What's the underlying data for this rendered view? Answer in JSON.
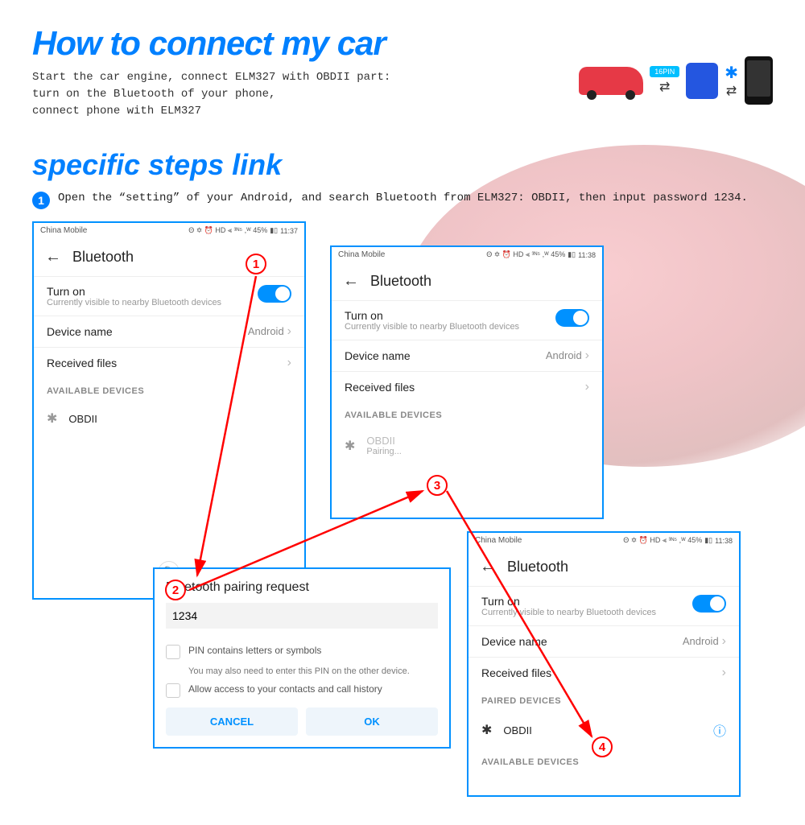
{
  "title1": "How to connect my car",
  "intro_line1": "Start the car engine, connect ELM327 with OBDII part:",
  "intro_line2": "turn on the Bluetooth of your phone,",
  "intro_line3": "connect phone with ELM327",
  "diagram": {
    "pin_label": "16PIN"
  },
  "title2": "specific steps link",
  "step1_text": "Open the “setting” of your Android, and search Bluetooth from ELM327: OBDII, then input password 1234.",
  "status": {
    "carrier": "China Mobile",
    "icons": "Θ ✡ ⏰ HD ⫷ ³ᴺ⁵ ,ᵂ 45%",
    "time1": "11:37",
    "time2": "11:38",
    "time3": "11:38"
  },
  "bt_header": "Bluetooth",
  "turn_on": {
    "label": "Turn on",
    "sub": "Currently visible to nearby Bluetooth devices"
  },
  "device_name": {
    "label": "Device name",
    "value": "Android"
  },
  "received_files": "Received files",
  "available_devices": "AVAILABLE DEVICES",
  "paired_devices": "PAIRED DEVICES",
  "obdii": "OBDII",
  "pairing": "Pairing...",
  "dialog": {
    "title": "Bluetooth pairing request",
    "pin_value": "1234",
    "check1": "PIN contains letters or symbols",
    "note": "You may also need to enter this PIN on the other device.",
    "check2": "Allow access to your contacts and call history",
    "cancel": "CANCEL",
    "ok": "OK"
  },
  "search": "Search",
  "markers": {
    "m1": "1",
    "m2": "2",
    "m3": "3",
    "m4": "4"
  }
}
